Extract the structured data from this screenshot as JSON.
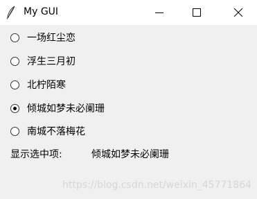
{
  "window": {
    "title": "My GUI",
    "icon": "feather-icon",
    "controls": [
      "minimize-icon",
      "maximize-icon",
      "close-icon"
    ]
  },
  "options": [
    {
      "label": "一场红尘恋",
      "checked": false
    },
    {
      "label": "浮生三月初",
      "checked": false
    },
    {
      "label": "北柠陌寒",
      "checked": false
    },
    {
      "label": "倾城如梦未必阑珊",
      "checked": true
    },
    {
      "label": "南城不落梅花",
      "checked": false
    }
  ],
  "selection": {
    "label": "显示选中项:",
    "value": "倾城如梦未必阑珊"
  },
  "watermark": "https://blog.csdn.net/weixin_45771864"
}
